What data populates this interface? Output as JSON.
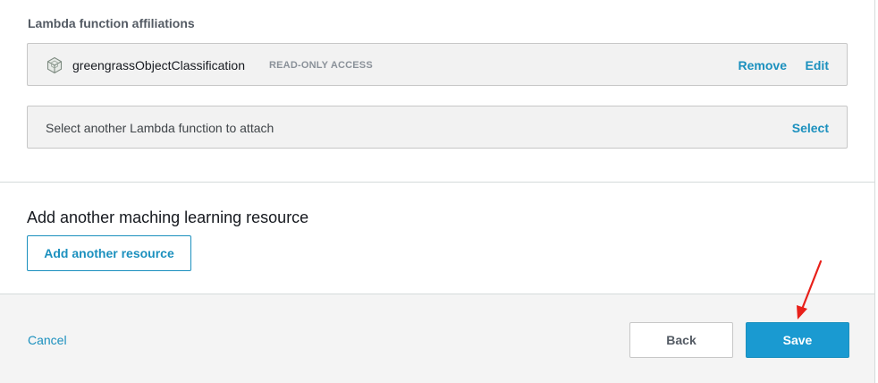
{
  "lambda_section": {
    "label": "Lambda function affiliations",
    "functions": [
      {
        "name": "greengrassObjectClassification",
        "access": "READ-ONLY ACCESS",
        "icon": "lambda-cube-icon",
        "remove_label": "Remove",
        "edit_label": "Edit"
      }
    ],
    "select_prompt": "Select another Lambda function to attach",
    "select_label": "Select"
  },
  "resource_section": {
    "heading": "Add another maching learning resource",
    "add_button_label": "Add another resource"
  },
  "footer": {
    "cancel_label": "Cancel",
    "back_label": "Back",
    "save_label": "Save"
  },
  "colors": {
    "accent": "#1b90be",
    "primary_button": "#1a9ad1",
    "annotation_arrow": "#e8201a"
  }
}
